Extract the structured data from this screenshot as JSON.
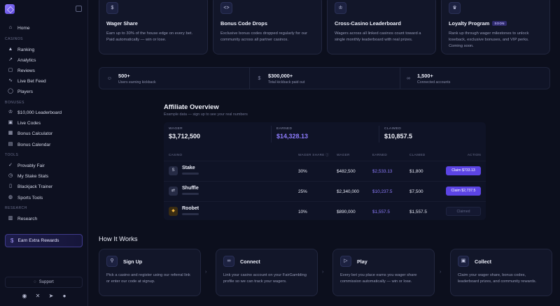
{
  "sidebar": {
    "home": "Home",
    "sections": {
      "casinos": "CASINOS",
      "bonuses": "BONUSES",
      "tools": "TOOLS",
      "research": "RESEARCH"
    },
    "casinos": [
      "Ranking",
      "Analytics",
      "Reviews",
      "Live Bet Feed",
      "Players"
    ],
    "bonuses": [
      "$10,000 Leaderboard",
      "Live Codes",
      "Bonus Calculator",
      "Bonus Calendar"
    ],
    "tools": [
      "Provably Fair",
      "My Stake Stats",
      "Blackjack Trainer",
      "Sports Tools"
    ],
    "research": [
      "Research"
    ],
    "earn_button": "Earn Extra Rewards",
    "support": "Support"
  },
  "features": [
    {
      "title": "Wager Share",
      "desc": "Earn up to 30% of the house edge on every bet. Paid automatically — win or lose.",
      "icon": "dollar-icon"
    },
    {
      "title": "Bonus Code Drops",
      "desc": "Exclusive bonus codes dropped regularly for our community across all partner casinos.",
      "icon": "code-icon"
    },
    {
      "title": "Cross-Casino Leaderboard",
      "desc": "Wagers across all linked casinos count toward a single monthly leaderboard with real prizes.",
      "icon": "trophy-icon"
    },
    {
      "title": "Loyalty Program",
      "badge": "SOON",
      "desc": "Rank up through wager milestones to unlock loseback, exclusive bonuses, and VIP perks. Coming soon.",
      "icon": "crown-icon"
    }
  ],
  "stats": [
    {
      "value": "500+",
      "label": "Users earning kickback",
      "icon": "users-icon"
    },
    {
      "value": "$300,000+",
      "label": "Total kickback paid out",
      "icon": "dollar-icon"
    },
    {
      "value": "1,500+",
      "label": "Connected accounts",
      "icon": "link-icon"
    }
  ],
  "overview": {
    "title": "Affiliate Overview",
    "subtitle": "Example data — sign up to see your real numbers",
    "totals": [
      {
        "label": "WAGER",
        "value": "$3,712,500"
      },
      {
        "label": "EARNED",
        "value": "$14,328.13"
      },
      {
        "label": "CLAIMED",
        "value": "$10,857.5"
      }
    ],
    "columns": {
      "casino": "CASINO",
      "share": "WAGER SHARE ⓘ",
      "wager": "WAGER",
      "earned": "EARNED",
      "claimed": "CLAIMED",
      "action": "ACTION"
    },
    "rows": [
      {
        "casino": "Stake",
        "share": "30%",
        "wager": "$482,500",
        "earned": "$2,533.13",
        "claimed": "$1,800",
        "action": "Claim $733.13"
      },
      {
        "casino": "Shuffle",
        "share": "25%",
        "wager": "$2,340,000",
        "earned": "$10,237.5",
        "claimed": "$7,500",
        "action": "Claim $2,737.5"
      },
      {
        "casino": "Roobet",
        "share": "10%",
        "wager": "$890,000",
        "earned": "$1,557.5",
        "claimed": "$1,557.5",
        "action": "Claimed"
      }
    ]
  },
  "how_it_works": {
    "title": "How It Works",
    "steps": [
      {
        "title": "Sign Up",
        "desc": "Pick a casino and register using our referral link or enter our code at signup.",
        "icon": "user-plus-icon"
      },
      {
        "title": "Connect",
        "desc": "Link your casino account on your FairGambling profile so we can track your wagers.",
        "icon": "link-icon"
      },
      {
        "title": "Play",
        "desc": "Every bet you place earns you wager share commission automatically — win or lose.",
        "icon": "play-icon"
      },
      {
        "title": "Collect",
        "desc": "Claim your wager share, bonus codes, leaderboard prizes, and community rewards.",
        "icon": "gift-icon"
      }
    ]
  }
}
